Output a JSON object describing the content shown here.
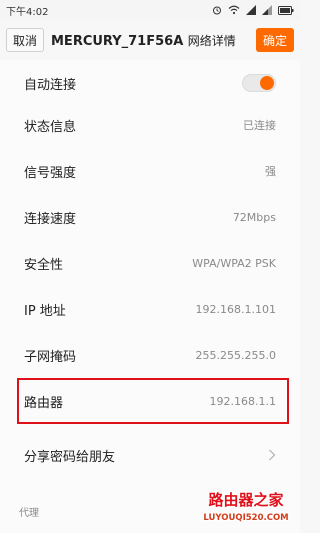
{
  "status_bar": {
    "time": "下午4:02",
    "icons": [
      "alarm-icon",
      "wifi-icon",
      "signal-icon",
      "signal-icon",
      "battery-icon"
    ]
  },
  "title_bar": {
    "cancel_label": "取消",
    "title": "MERCURY_71F56A",
    "title_suffix": "网络详情",
    "confirm_label": "确定",
    "accent_color": "#ff6a00"
  },
  "rows": [
    {
      "label": "自动连接",
      "toggle_on": true
    },
    {
      "label": "状态信息",
      "value": "已连接"
    },
    {
      "label": "信号强度",
      "value": "强"
    },
    {
      "label": "连接速度",
      "value": "72Mbps"
    },
    {
      "label": "安全性",
      "value": "WPA/WPA2 PSK"
    },
    {
      "label": "IP 地址",
      "value": "192.168.1.101"
    },
    {
      "label": "子网掩码",
      "value": "255.255.255.0"
    },
    {
      "label": "路由器",
      "value": "192.168.1.1"
    },
    {
      "label": "分享密码给朋友"
    }
  ],
  "section": {
    "proxy_label": "代理"
  },
  "watermark": {
    "line1": "路由器之家",
    "line2": "LUYOUQI520.COM",
    "highlight_color": "#e0101a"
  }
}
